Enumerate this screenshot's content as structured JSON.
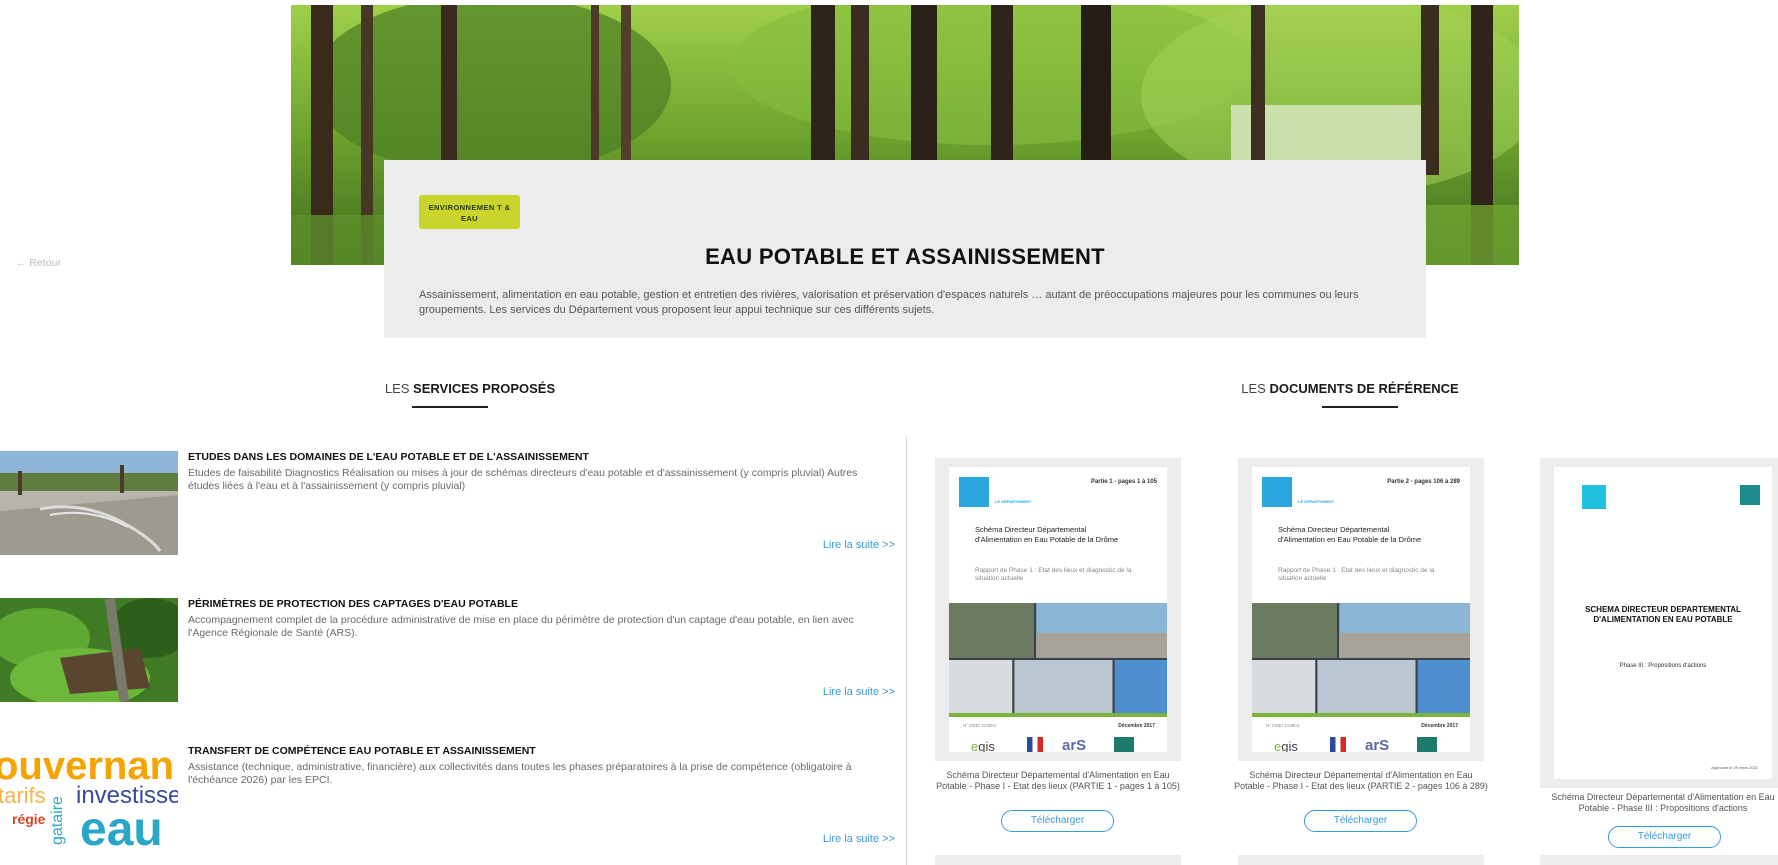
{
  "nav": {
    "back_label": "← Retour"
  },
  "hero": {
    "tag": "ENVIRONNEMEN T & EAU"
  },
  "intro": {
    "title": "EAU POTABLE ET ASSAINISSEMENT",
    "text": "Assainissement, alimentation en eau potable, gestion et entretien des rivières, valorisation et préservation d'espaces naturels … autant de préoccupations majeures pour les communes ou leurs groupements. Les services du  Département vous proposent leur appui technique sur ces différents sujets."
  },
  "services_heading": {
    "prefix": "LES ",
    "bold": "SERVICES PROPOSÉS"
  },
  "documents_heading": {
    "prefix": "LES ",
    "bold": "DOCUMENTS DE RÉFÉRENCE"
  },
  "services": [
    {
      "title": "ETUDES DANS LES DOMAINES DE L'EAU POTABLE ET DE L'ASSAINISSEMENT",
      "description": "Etudes de faisabilité Diagnostics Réalisation ou mises à jour de schémas directeurs d'eau potable et d'assainissement (y compris pluvial) Autres études liées à l'eau et à l'assainissement (y compris pluvial)",
      "more": "Lire la suite >>"
    },
    {
      "title": "PÉRIMÈTRES DE PROTECTION DES CAPTAGES D'EAU POTABLE",
      "description": "Accompagnement complet de la procédure administrative de mise en place du périmètre de protection d'un captage d'eau potable, en lien avec l'Agence Régionale de Santé (ARS).",
      "more": "Lire la suite >>"
    },
    {
      "title": "TRANSFERT DE COMPÉTENCE EAU POTABLE ET ASSAINISSEMENT",
      "description": "Assistance (technique, administrative, financière) aux collectivités dans toutes les phases préparatoires à la prise de compétence (obligatoire à l'échéance 2026) par les EPCI.",
      "more": "Lire la suite >>",
      "image_words": {
        "w1": "ouvernan",
        "w2": "tarifs",
        "w3": "investisse",
        "w4": "régie",
        "w5": "gataire",
        "w6": "eau"
      }
    }
  ],
  "documents": [
    {
      "page": {
        "partie": "Partie 1 - pages 1 à 105",
        "dept": "LE DÉPARTEMENT",
        "title": "Schéma Directeur Départemental d'Alimentation en Eau Potable de la Drôme",
        "subtitle": "Rapport de Phase 1 : Etat des lieux et diagnostic de la situation actuelle",
        "date": "Décembre 2017",
        "ref": "N° DDE/ 213801"
      },
      "caption": "Schéma Directeur Départemental d'Alimentation en Eau Potable - Phase I - Etat des lieux (PARTIE 1 - pages 1 à 105)",
      "download": "Télécharger"
    },
    {
      "page": {
        "partie": "Partie 2 - pages 106 à 289",
        "dept": "LE DÉPARTEMENT",
        "title": "Schéma Directeur Départemental d'Alimentation en Eau Potable de la Drôme",
        "subtitle": "Rapport de Phase 1 : Etat des lieux et diagnostic de la situation actuelle",
        "date": "Décembre 2017",
        "ref": "N° DDE/ 213801"
      },
      "caption": "Schéma Directeur Départemental d'Alimentation en Eau Potable - Phase I - Etat des lieux (PARTIE 2 - pages 106 à 289)",
      "download": "Télécharger"
    },
    {
      "page": {
        "title": "SCHEMA DIRECTEUR DEPARTEMENTAL D'ALIMENTATION EN EAU POTABLE",
        "subtitle": "Phase III : Propositions d'actions",
        "date": "Approuvé le 29 mars 2021"
      },
      "caption": "Schéma Directeur Départemental d'Alimentation en Eau Potable - Phase III : Propositions d'actions",
      "download": "Télécharger"
    }
  ],
  "logos": {
    "egis_e": "e",
    "egis": "gis",
    "ars": "arS"
  },
  "colors": {
    "accent_blue": "#3a9ad9",
    "tag_green": "#c9d42c",
    "card_gray": "#ececec"
  }
}
